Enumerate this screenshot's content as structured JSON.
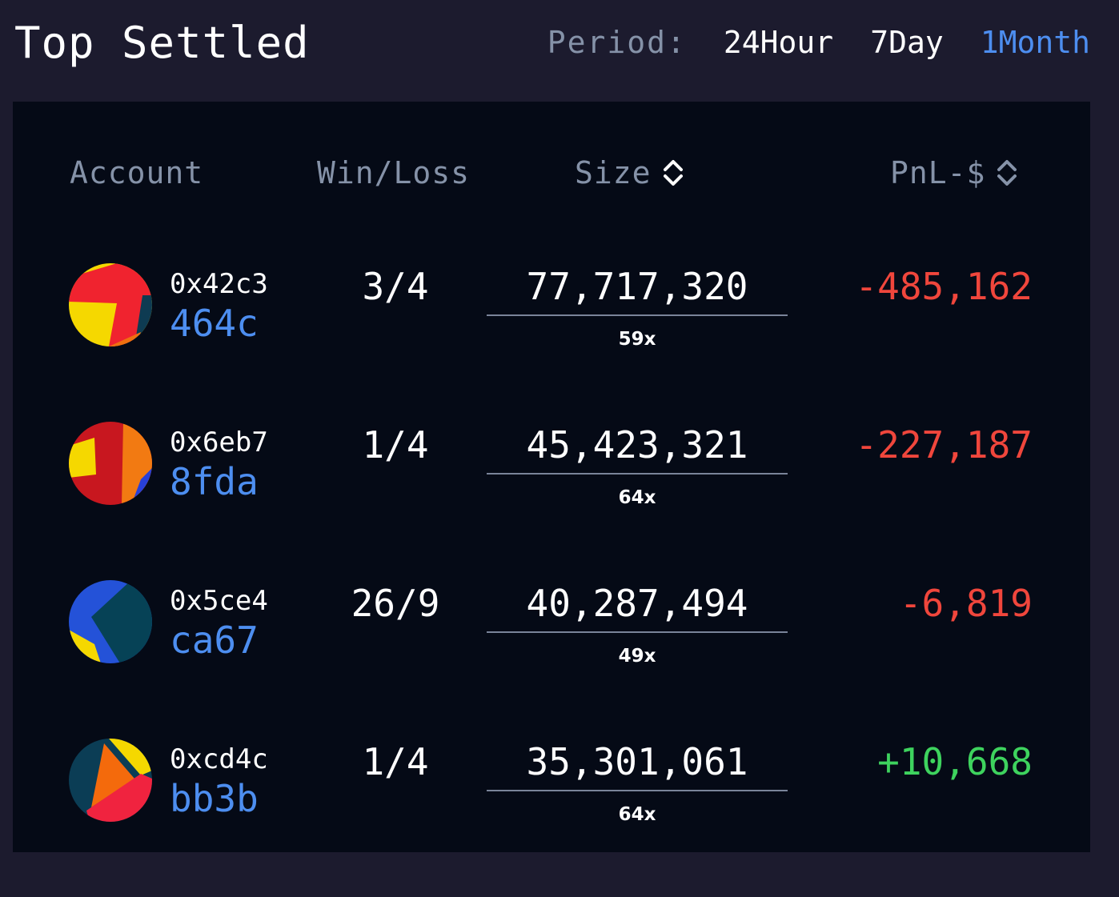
{
  "header": {
    "title": "Top Settled",
    "period_label": "Period:",
    "period_options": [
      {
        "label": "24Hour",
        "active": false
      },
      {
        "label": "7Day",
        "active": false
      },
      {
        "label": "1Month",
        "active": true
      }
    ]
  },
  "table": {
    "columns": {
      "account": "Account",
      "winloss": "Win/Loss",
      "size": "Size",
      "pnl": "PnL-$"
    },
    "rows": [
      {
        "account_top": "0x42c3",
        "account_bottom": "464c",
        "winloss": "3/4",
        "size": "77,717,320",
        "leverage": "59x",
        "pnl": "-485,162",
        "pnl_color": "#f0463c"
      },
      {
        "account_top": "0x6eb7",
        "account_bottom": "8fda",
        "winloss": "1/4",
        "size": "45,423,321",
        "leverage": "64x",
        "pnl": "-227,187",
        "pnl_color": "#f0463c"
      },
      {
        "account_top": "0x5ce4",
        "account_bottom": "ca67",
        "winloss": "26/9",
        "size": "40,287,494",
        "leverage": "49x",
        "pnl": "-6,819",
        "pnl_color": "#f0463c"
      },
      {
        "account_top": "0xcd4c",
        "account_bottom": "bb3b",
        "winloss": "1/4",
        "size": "35,301,061",
        "leverage": "64x",
        "pnl": "+10,668",
        "pnl_color": "#3ed35e"
      }
    ]
  },
  "colors": {
    "accent": "#4d8ef0",
    "loss": "#f0463c",
    "gain": "#3ed35e",
    "muted": "#8592a8",
    "page_bg": "#1c1b2e",
    "panel_bg": "#050a16"
  }
}
